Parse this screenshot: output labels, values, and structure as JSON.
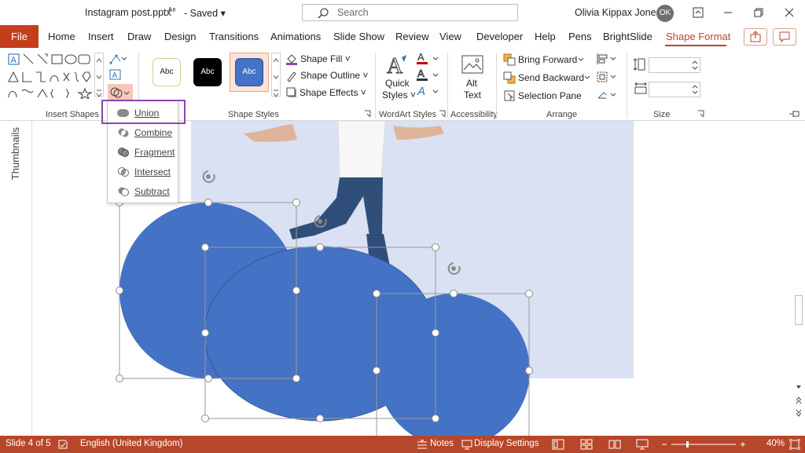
{
  "titlebar": {
    "file_name": "Instagram post.pptx",
    "save_state": "Saved",
    "search_placeholder": "Search",
    "user_name": "Olivia Kippax Jones",
    "user_initials": "OK"
  },
  "tabs": {
    "file": "File",
    "items": [
      "Home",
      "Insert",
      "Draw",
      "Design",
      "Transitions",
      "Animations",
      "Slide Show",
      "Review",
      "View",
      "Developer",
      "Help",
      "Pens",
      "BrightSlide",
      "Shape Format"
    ],
    "active": "Shape Format"
  },
  "ribbon": {
    "groups": {
      "insert_shapes": "Insert Shapes",
      "shape_styles": "Shape Styles",
      "wordart_styles": "WordArt Styles",
      "accessibility": "Accessibility",
      "arrange": "Arrange",
      "size": "Size"
    },
    "style_swatch_label": "Abc",
    "shape_fill": "Shape Fill",
    "shape_outline": "Shape Outline",
    "shape_effects": "Shape Effects",
    "quick_styles_line1": "Quick",
    "quick_styles_line2": "Styles",
    "alt_text_line1": "Alt",
    "alt_text_line2": "Text",
    "bring_forward": "Bring Forward",
    "send_backward": "Send Backward",
    "selection_pane": "Selection Pane"
  },
  "merge_menu": {
    "items": [
      "Union",
      "Combine",
      "Fragment",
      "Intersect",
      "Subtract"
    ],
    "highlighted": "Union"
  },
  "workspace": {
    "thumbnails_label": "Thumbnails"
  },
  "status": {
    "slide": "Slide 4 of 5",
    "language": "English (United Kingdom)",
    "notes": "Notes",
    "display_settings": "Display Settings",
    "zoom": "40%"
  },
  "colors": {
    "accent": "#b7472a",
    "file_tab": "#c43e1c",
    "shape_fill": "#4472c4",
    "slide_bg": "#d9e1f2",
    "highlight": "#8e44ad"
  }
}
